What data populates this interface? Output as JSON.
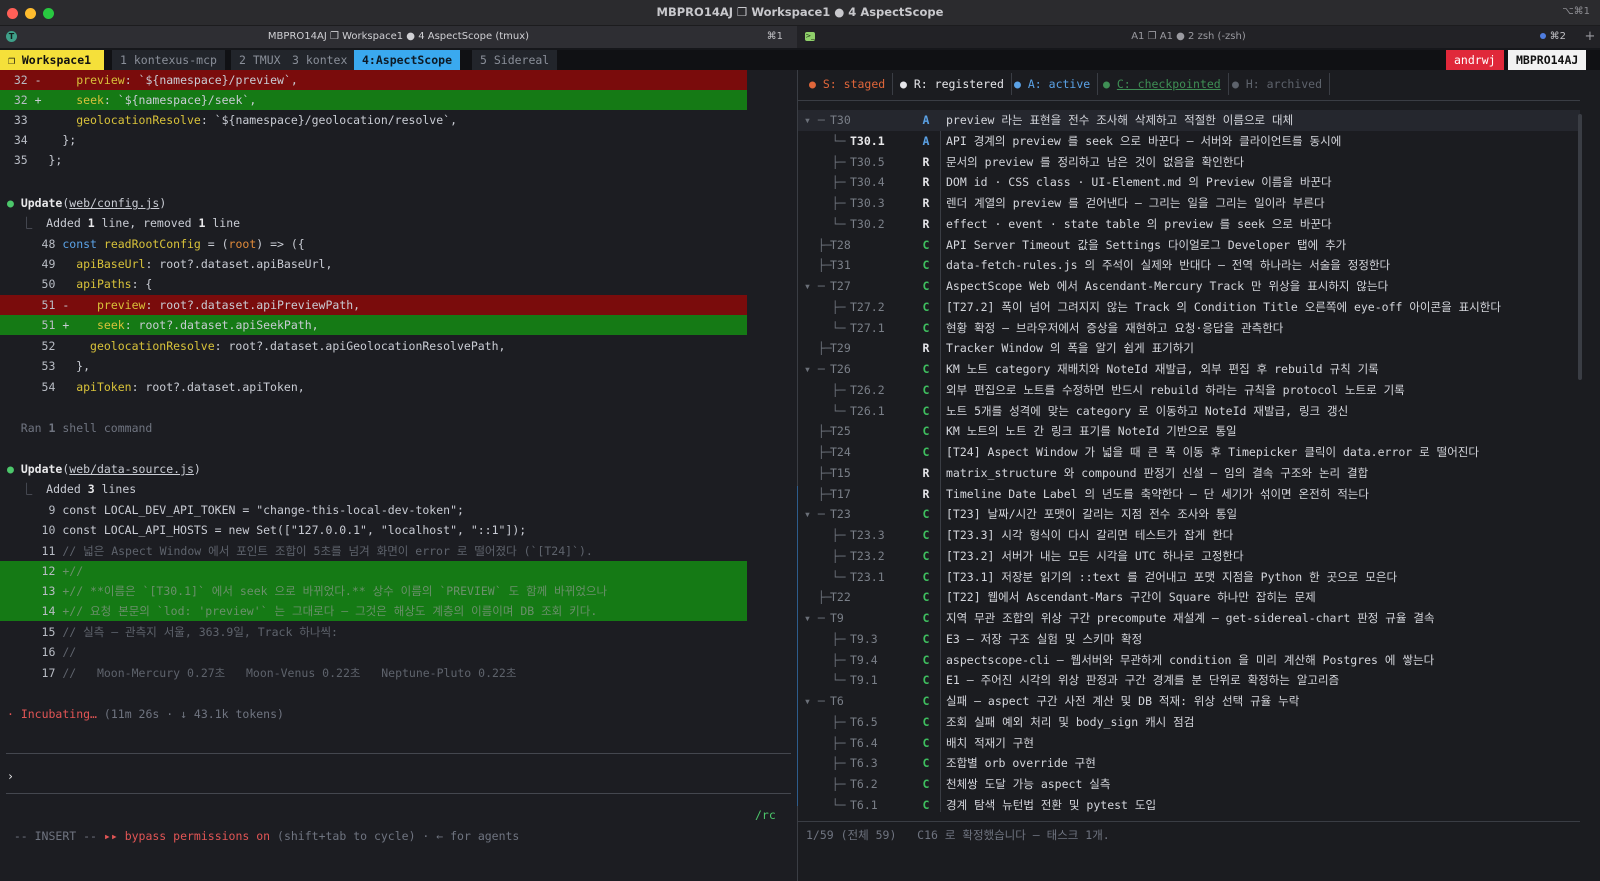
{
  "window": {
    "title": "MBPRO14AJ ❐ Workspace1 ● 4 AspectScope",
    "shortcut": "⌥⌘1"
  },
  "tabs": [
    {
      "title": "MBPRO14AJ ❐ Workspace1 ● 4 AspectScope (tmux)",
      "shortcut": "⌘1"
    },
    {
      "title": "A1 ❐ A1 ● 2 zsh (-zsh)",
      "shortcut": "⌘2"
    }
  ],
  "tmux": {
    "session": "❐ Workspace1",
    "windows": [
      "1 kontexus-mcp",
      "2 TMUX",
      "3 kontex",
      "4:AspectScope",
      "5 Sidereal"
    ],
    "user": "andrwj",
    "host": "MBPRO14AJ"
  },
  "left": {
    "diff1": [
      {
        "num": "32",
        "sign": "-",
        "key": "preview",
        "val": "`${namespace}/preview`,"
      },
      {
        "num": "32",
        "sign": "+",
        "key": "seek",
        "val": "`${namespace}/seek`,"
      },
      {
        "num": "33",
        "sign": " ",
        "key": "geolocationResolve",
        "val": "`${namespace}/geolocation/resolve`,"
      },
      {
        "num": "34",
        "text": "};"
      },
      {
        "num": "35",
        "text": "};"
      }
    ],
    "update1": {
      "label": "Update",
      "file": "web/config.js",
      "summary_pre": "Added ",
      "n1": "1",
      "summary_mid": " line, removed ",
      "n2": "1",
      "summary_post": " line"
    },
    "diff2": [
      {
        "num": "48",
        "text": "const readRootConfig = (root) => ({"
      },
      {
        "num": "49",
        "text": "  apiBaseUrl: root?.dataset.apiBaseUrl,"
      },
      {
        "num": "50",
        "text": "  apiPaths: {"
      },
      {
        "num": "51",
        "sign": "-",
        "text": "    preview: root?.dataset.apiPreviewPath,"
      },
      {
        "num": "51",
        "sign": "+",
        "text": "    seek: root?.dataset.apiSeekPath,"
      },
      {
        "num": "52",
        "text": "    geolocationResolve: root?.dataset.apiGeolocationResolvePath,"
      },
      {
        "num": "53",
        "text": "  },"
      },
      {
        "num": "54",
        "text": "  apiToken: root?.dataset.apiToken,"
      }
    ],
    "ran": {
      "pre": "Ran ",
      "n": "1",
      "post": " shell command"
    },
    "update2": {
      "label": "Update",
      "file": "web/data-source.js",
      "summary_pre": "Added ",
      "n1": "3",
      "summary_post": " lines"
    },
    "diff3": [
      {
        "num": "9",
        "text": "const LOCAL_DEV_API_TOKEN = \"change-this-local-dev-token\";"
      },
      {
        "num": "10",
        "text": "const LOCAL_API_HOSTS = new Set([\"127.0.0.1\", \"localhost\", \"::1\"]);"
      },
      {
        "num": "11",
        "text": "// 넓은 Aspect Window 에서 포인트 조합이 5초를 넘겨 화면이 error 로 떨어졌다 (`[T24]`)."
      },
      {
        "num": "12",
        "sign": "+",
        "text": "//"
      },
      {
        "num": "13",
        "sign": "+",
        "text": "// **이름은 `[T30.1]` 에서 seek 으로 바뀌었다.** 상수 이름의 `PREVIEW` 도 함께 바뀌었으나"
      },
      {
        "num": "14",
        "sign": "+",
        "text": "// 요청 본문의 `lod: 'preview'` 는 그대로다 — 그것은 해상도 계층의 이름이며 DB 조회 키다."
      },
      {
        "num": "15",
        "text": "// 실측 — 관측지 서울, 363.9일, Track 하나씩:"
      },
      {
        "num": "16",
        "text": "//"
      },
      {
        "num": "17",
        "text": "//   Moon-Mercury 0.27초   Moon-Venus 0.22초   Neptune-Pluto 0.22초"
      }
    ],
    "status": {
      "verb": "Incubating…",
      "detail": "(11m 26s · ↓ 43.1k tokens)"
    },
    "prompt": "›",
    "rc": "/rc",
    "mode": "-- INSERT --",
    "bypass_icon": "▸▸",
    "bypass": "bypass permissions on",
    "bypass_hint": "(shift+tab to cycle) · ← for agents"
  },
  "right": {
    "legend": [
      {
        "dot": "●",
        "label": "S: staged",
        "color": "#e0663a"
      },
      {
        "dot": "●",
        "label": "R: registered",
        "color": "#e6e6ea"
      },
      {
        "dot": "●",
        "label": "A: active",
        "color": "#5ba2e6"
      },
      {
        "dot": "●",
        "label": "C: checkpointed",
        "color": "#3f8f55"
      },
      {
        "dot": "●",
        "label": "H: archived",
        "color": "#5e636c"
      }
    ],
    "tasks": [
      {
        "tree": "▾ ─",
        "id": "T30",
        "depth": 0,
        "status": "A",
        "title": "preview 라는 표현을 전수 조사해 삭제하고 적절한 이름으로 대체",
        "hl": true
      },
      {
        "tree": "    └─",
        "id": "T30.1",
        "depth": 1,
        "status": "A",
        "title": "API 경계의 preview 를 seek 으로 바꾼다 — 서버와 클라이언트를 동시에",
        "bold": true
      },
      {
        "tree": "    ├─",
        "id": "T30.5",
        "depth": 1,
        "status": "R",
        "title": "문서의 preview 를 정리하고 남은 것이 없음을 확인한다"
      },
      {
        "tree": "    ├─",
        "id": "T30.4",
        "depth": 1,
        "status": "R",
        "title": "DOM id · CSS class · UI-Element.md 의 Preview 이름을 바꾼다"
      },
      {
        "tree": "    ├─",
        "id": "T30.3",
        "depth": 1,
        "status": "R",
        "title": "렌더 계열의 preview 를 걷어낸다 — 그리는 일을 그리는 일이라 부른다"
      },
      {
        "tree": "    └─",
        "id": "T30.2",
        "depth": 1,
        "status": "R",
        "title": "effect · event · state table 의 preview 를 seek 으로 바꾼다"
      },
      {
        "tree": "  ├─",
        "id": "T28",
        "depth": 0,
        "status": "C",
        "title": "API Server Timeout 값을 Settings 다이얼로그 Developer 탭에 추가"
      },
      {
        "tree": "  ├─",
        "id": "T31",
        "depth": 0,
        "status": "C",
        "title": "data-fetch-rules.js 의 주석이 실제와 반대다 — 전역 하나라는 서술을 정정한다"
      },
      {
        "tree": "▾ ─",
        "id": "T27",
        "depth": 0,
        "status": "C",
        "title": "AspectScope Web 에서 Ascendant-Mercury Track 만 위상을 표시하지 않는다"
      },
      {
        "tree": "    ├─",
        "id": "T27.2",
        "depth": 1,
        "status": "C",
        "title": "[T27.2] 폭이 넘어 그려지지 않는 Track 의 Condition Title 오른쪽에 eye-off 아이콘을 표시한다"
      },
      {
        "tree": "    └─",
        "id": "T27.1",
        "depth": 1,
        "status": "C",
        "title": "현황 확정 — 브라우저에서 증상을 재현하고 요청·응답을 관측한다"
      },
      {
        "tree": "  ├─",
        "id": "T29",
        "depth": 0,
        "status": "R",
        "title": "Tracker Window 의 폭을 알기 쉽게 표기하기"
      },
      {
        "tree": "▾ ─",
        "id": "T26",
        "depth": 0,
        "status": "C",
        "title": "KM 노트 category 재배치와 NoteId 재발급, 외부 편집 후 rebuild 규칙 기록"
      },
      {
        "tree": "    ├─",
        "id": "T26.2",
        "depth": 1,
        "status": "C",
        "title": "외부 편집으로 노트를 수정하면 반드시 rebuild 하라는 규칙을 protocol 노트로 기록"
      },
      {
        "tree": "    └─",
        "id": "T26.1",
        "depth": 1,
        "status": "C",
        "title": "노트 5개를 성격에 맞는 category 로 이동하고 NoteId 재발급, 링크 갱신"
      },
      {
        "tree": "  ├─",
        "id": "T25",
        "depth": 0,
        "status": "C",
        "title": "KM 노트의 노트 간 링크 표기를 NoteId 기반으로 통일"
      },
      {
        "tree": "  ├─",
        "id": "T24",
        "depth": 0,
        "status": "C",
        "title": "[T24] Aspect Window 가 넓을 때 큰 폭 이동 후 Timepicker 클릭이 data.error 로 떨어진다"
      },
      {
        "tree": "  ├─",
        "id": "T15",
        "depth": 0,
        "status": "R",
        "title": "matrix_structure 와 compound 판정기 신설 — 임의 결속 구조와 논리 결합"
      },
      {
        "tree": "  ├─",
        "id": "T17",
        "depth": 0,
        "status": "R",
        "title": "Timeline Date Label 의 년도를 축약한다 — 단 세기가 섞이면 온전히 적는다"
      },
      {
        "tree": "▾ ─",
        "id": "T23",
        "depth": 0,
        "status": "C",
        "title": "[T23] 날짜/시간 포맷이 갈리는 지점 전수 조사와 통일"
      },
      {
        "tree": "    ├─",
        "id": "T23.3",
        "depth": 1,
        "status": "C",
        "title": "[T23.3] 시각 형식이 다시 갈리면 테스트가 잡게 한다"
      },
      {
        "tree": "    ├─",
        "id": "T23.2",
        "depth": 1,
        "status": "C",
        "title": "[T23.2] 서버가 내는 모든 시각을 UTC 하나로 고정한다"
      },
      {
        "tree": "    └─",
        "id": "T23.1",
        "depth": 1,
        "status": "C",
        "title": "[T23.1] 저장분 읽기의 ::text 를 걷어내고 포맷 지점을 Python 한 곳으로 모은다"
      },
      {
        "tree": "  ├─",
        "id": "T22",
        "depth": 0,
        "status": "C",
        "title": "[T22] 웹에서 Ascendant-Mars 구간이 Square 하나만 잡히는 문제"
      },
      {
        "tree": "▾ ─",
        "id": "T9",
        "depth": 0,
        "status": "C",
        "title": "지역 무관 조합의 위상 구간 precompute 재설계 — get-sidereal-chart 판정 규율 결속"
      },
      {
        "tree": "    ├─",
        "id": "T9.3",
        "depth": 1,
        "status": "C",
        "title": "E3 — 저장 구조 실험 및 스키마 확정"
      },
      {
        "tree": "    ├─",
        "id": "T9.4",
        "depth": 1,
        "status": "C",
        "title": "aspectscope-cli — 웹서버와 무관하게 condition 을 미리 계산해 Postgres 에 쌓는다"
      },
      {
        "tree": "    └─",
        "id": "T9.1",
        "depth": 1,
        "status": "C",
        "title": "E1 — 주어진 시각의 위상 판정과 구간 경계를 분 단위로 확정하는 알고리즘"
      },
      {
        "tree": "▾ ─",
        "id": "T6",
        "depth": 0,
        "status": "C",
        "title": "실패 — aspect 구간 사전 계산 및 DB 적재: 위상 선택 규율 누락"
      },
      {
        "tree": "    ├─",
        "id": "T6.5",
        "depth": 1,
        "status": "C",
        "title": "조회 실패 예외 처리 및 body_sign 캐시 점검"
      },
      {
        "tree": "    ├─",
        "id": "T6.4",
        "depth": 1,
        "status": "C",
        "title": "배치 적재기 구현"
      },
      {
        "tree": "    ├─",
        "id": "T6.3",
        "depth": 1,
        "status": "C",
        "title": "조합별 orb override 구현"
      },
      {
        "tree": "    ├─",
        "id": "T6.2",
        "depth": 1,
        "status": "C",
        "title": "천체쌍 도달 가능 aspect 실측"
      },
      {
        "tree": "    └─",
        "id": "T6.1",
        "depth": 1,
        "status": "C",
        "title": "경계 탐색 뉴턴법 전환 및 pytest 도입"
      }
    ],
    "footer": "1/59 (전체 59)   C16 로 확정했습니다 — 태스크 1개."
  }
}
